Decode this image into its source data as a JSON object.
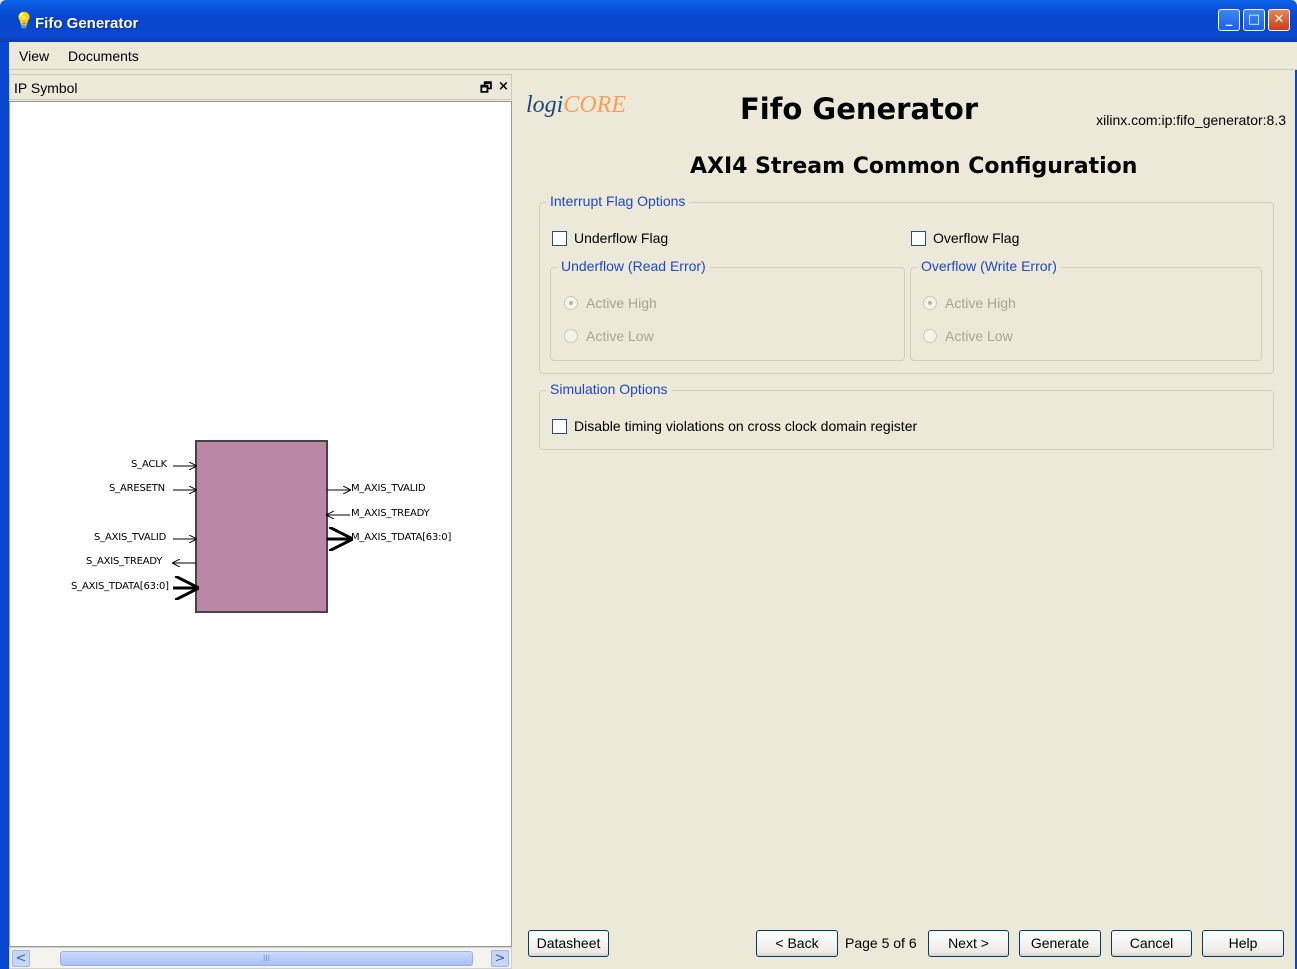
{
  "window": {
    "title": "Fifo Generator",
    "controls": {
      "minimize": "_",
      "maximize": "□",
      "close": "✕"
    }
  },
  "menu": {
    "items": [
      "View",
      "Documents"
    ]
  },
  "left_panel": {
    "title": "IP Symbol",
    "float_glyph": "🗗",
    "close_glyph": "×",
    "symbol": {
      "block_color": "#bc87a6",
      "inputs": [
        "S_ACLK",
        "S_ARESETN",
        "S_AXIS_TVALID",
        "S_AXIS_TREADY",
        "S_AXIS_TDATA[63:0]"
      ],
      "outputs": [
        "M_AXIS_TVALID",
        "M_AXIS_TREADY",
        "M_AXIS_TDATA[63:0]"
      ]
    },
    "scroll": {
      "left": "<",
      "right": ">",
      "thumb": "III"
    }
  },
  "header": {
    "logo_prefix": "logi",
    "logo_core": "CORE",
    "title": "Fifo Generator",
    "vlnv": "xilinx.com:ip:fifo_generator:8.3",
    "subtitle": "AXI4 Stream Common Configuration"
  },
  "interrupt": {
    "label": "Interrupt Flag Options",
    "underflow_flag": "Underflow Flag",
    "overflow_flag": "Overflow Flag",
    "underflow_group": "Underflow (Read Error)",
    "overflow_group": "Overflow (Write Error)",
    "active_high": "Active High",
    "active_low": "Active Low"
  },
  "simulation": {
    "label": "Simulation Options",
    "disable_timing": "Disable timing violations on cross clock domain register"
  },
  "footer": {
    "datasheet": "Datasheet",
    "back": "< Back",
    "page": "Page 5 of 6",
    "next": "Next >",
    "generate": "Generate",
    "cancel": "Cancel",
    "help": "Help"
  },
  "colors": {
    "group_label": "#1f48c8",
    "title_bar": "#0a47d0"
  }
}
